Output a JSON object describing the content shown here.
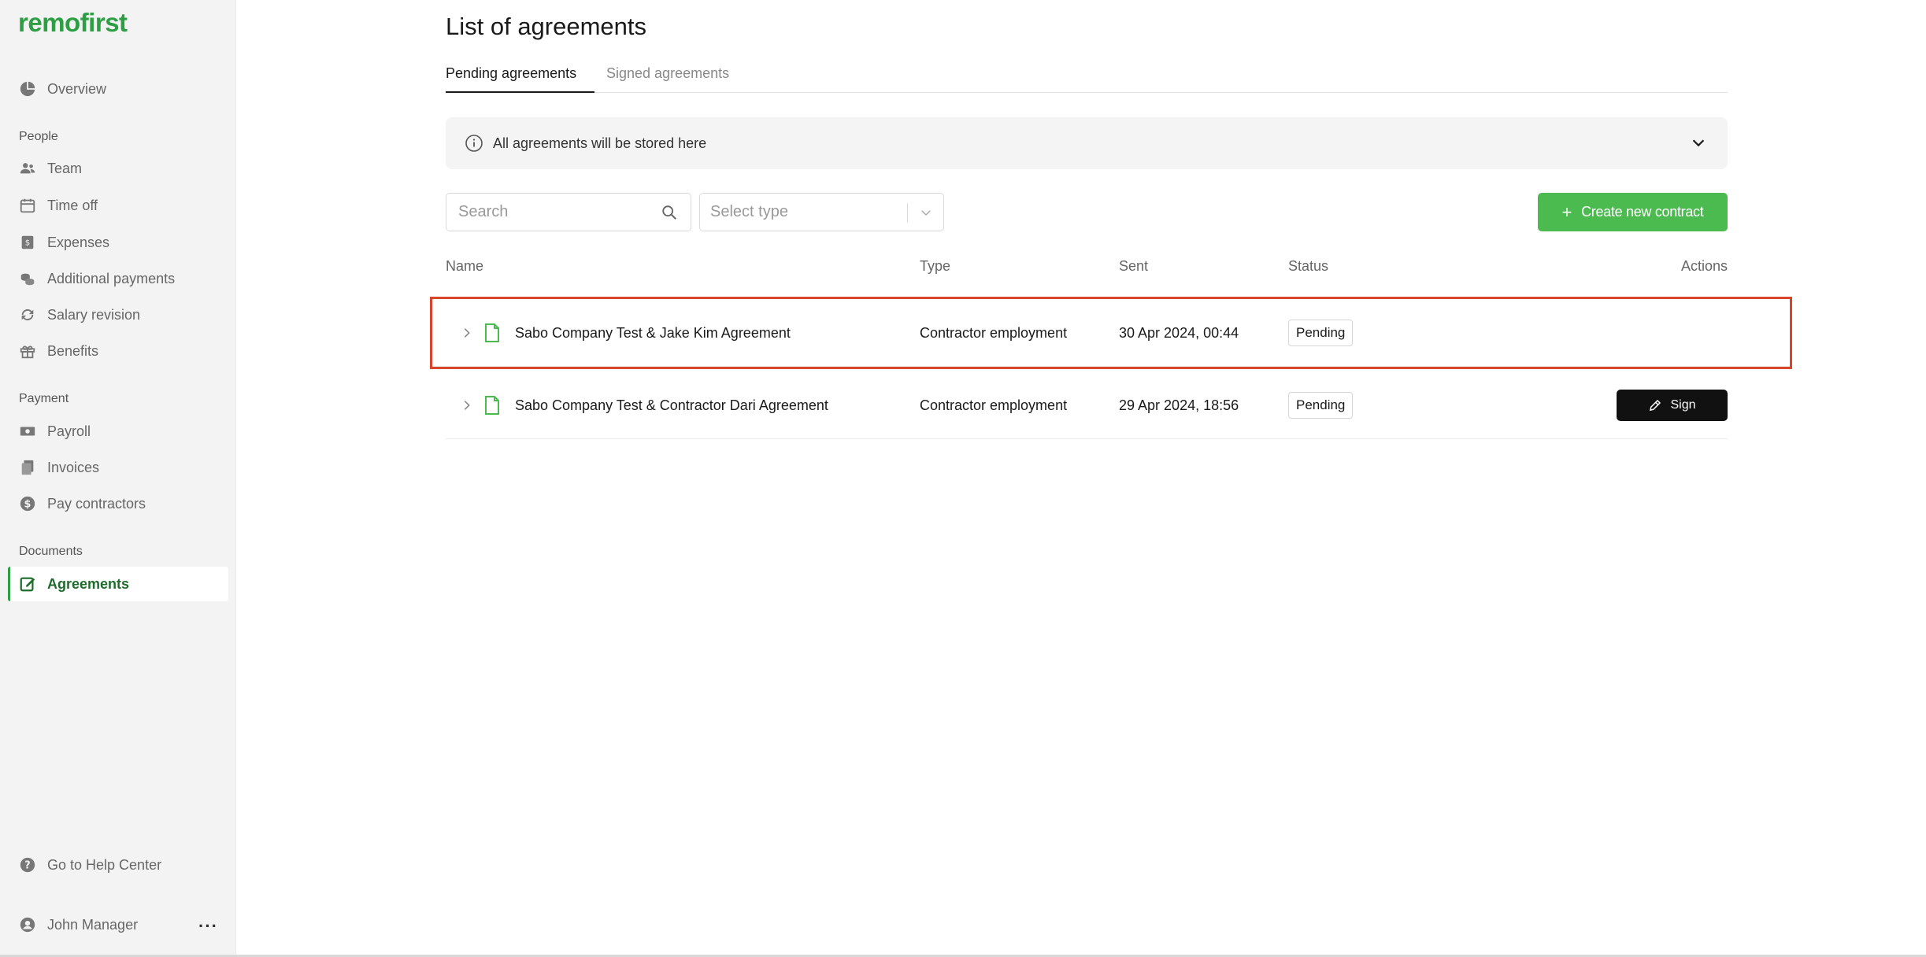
{
  "sidebar": {
    "logo": "remofirst",
    "overview": "Overview",
    "groups": {
      "people": "People",
      "payment": "Payment",
      "documents": "Documents"
    },
    "people_items": [
      "Team",
      "Time off",
      "Expenses",
      "Additional payments",
      "Salary revision",
      "Benefits"
    ],
    "payment_items": [
      "Payroll",
      "Invoices",
      "Pay contractors"
    ],
    "documents_items": [
      "Agreements"
    ],
    "help": "Go to Help Center",
    "user": "John Manager",
    "more": "···",
    "accent_color": "#2e9e44"
  },
  "main": {
    "title": "List of agreements",
    "tabs": [
      {
        "label": "Pending agreements",
        "active": true
      },
      {
        "label": "Signed agreements",
        "active": false
      }
    ],
    "info_banner": "All agreements will be stored here",
    "search": {
      "placeholder": "Search"
    },
    "type_select": {
      "placeholder": "Select type"
    },
    "create_button": {
      "icon": "+",
      "label": "Create new contract"
    },
    "columns": [
      "Name",
      "Type",
      "Sent",
      "Status",
      "Actions"
    ],
    "rows": [
      {
        "name": "Sabo Company Test & Jake Kim Agreement",
        "type": "Contractor employment",
        "sent": "30 Apr 2024, 00:44",
        "status": "Pending",
        "action": "",
        "highlighted": true
      },
      {
        "name": "Sabo Company Test & Contractor Dari Agreement",
        "type": "Contractor employment",
        "sent": "29 Apr 2024, 18:56",
        "status": "Pending",
        "action": "Sign",
        "highlighted": false
      }
    ],
    "brand_green": "#4cbb4f",
    "highlight_color": "#d9452b"
  }
}
